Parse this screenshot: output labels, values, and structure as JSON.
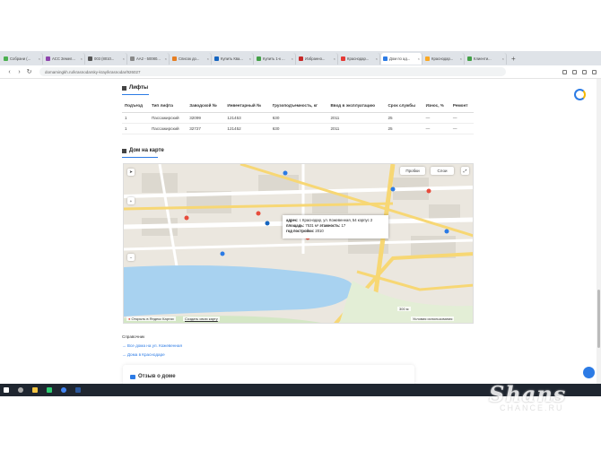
{
  "tabs": [
    {
      "label": "Собрани (...",
      "color": "#4caf50"
    },
    {
      "label": "ACC Земел...",
      "color": "#8e44ad"
    },
    {
      "label": "003 (8010...",
      "color": "#555"
    },
    {
      "label": "AA2 - 50080...",
      "color": "#888"
    },
    {
      "label": "Список до...",
      "color": "#e67e22"
    },
    {
      "label": "Купить Ква...",
      "color": "#1565c0"
    },
    {
      "label": "Купить 1-к ...",
      "color": "#43a047"
    },
    {
      "label": "Избраннo...",
      "color": "#c62828"
    },
    {
      "label": "Краснодар...",
      "color": "#e53935"
    },
    {
      "label": "Дом по ад...",
      "color": "#2c7be5"
    },
    {
      "label": "Краснодар...",
      "color": "#f9a825"
    },
    {
      "label": "Клиенти...",
      "color": "#43a047"
    }
  ],
  "address": "domamingkh.ru/krasnodarsky-kray/krasnodar/926027",
  "lifts": {
    "title": "Лифты",
    "headers": [
      "Подъезд",
      "Тип лифта",
      "Заводской №",
      "Инвентарный №",
      "Грузоподъемность, кг",
      "Ввод в эксплуатацию",
      "Срок службы",
      "Износ, %",
      "Ремонт"
    ],
    "rows": [
      [
        "1",
        "Пассажирский",
        "32099",
        "121453",
        "630",
        "2011",
        "25",
        "—",
        "—"
      ],
      [
        "1",
        "Пассажирский",
        "32727",
        "121452",
        "630",
        "2011",
        "25",
        "—",
        "—"
      ]
    ]
  },
  "map": {
    "title": "Дом на карте",
    "traffic": "Пробки",
    "layers": "Слои",
    "popup": {
      "address_label": "адрес:",
      "address": "г. Краснодар, ул. Кожевенная, 54 корпус 2",
      "area_label": "площадь:",
      "area": "7531 м²",
      "floors_label": "этажность:",
      "floors": "17",
      "year_label": "год постройки:",
      "year": "2010"
    },
    "open_yandex": "Открыть в Яндекс Картах",
    "create_map": "Создать свою карту",
    "terms": "Условия использования",
    "scale": "300 м"
  },
  "reference": {
    "label": "Справочник",
    "links": [
      "Все дома на ул. Кожевенная",
      "Дома в Краснодаре"
    ]
  },
  "review": {
    "title": "Отзыв о доме"
  },
  "watermark": {
    "brand": "Shans",
    "site": "CHANCE.RU"
  }
}
